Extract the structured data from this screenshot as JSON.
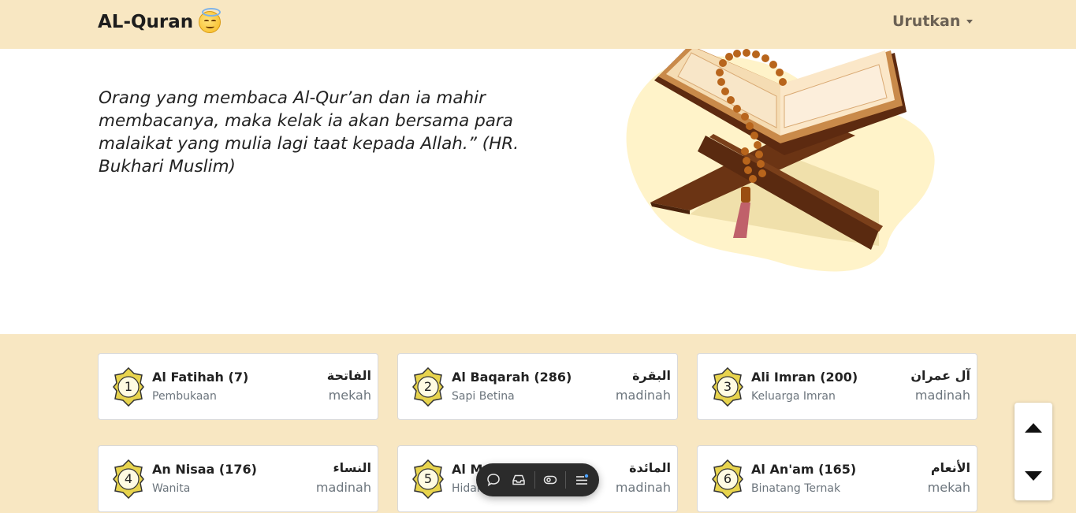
{
  "navbar": {
    "brand": "AL-Quran",
    "brand_emoji": "smiling-face-with-halo",
    "sort_label": "Urutkan"
  },
  "hero": {
    "quote": "Orang yang membaca Al-Qur’an dan ia mahir membacanya, maka kelak ia akan bersama para malaikat yang mulia lagi taat kepada Allah.” (HR. Bukhari Muslim)"
  },
  "surahs": [
    {
      "number": "1",
      "name": "Al Fatihah (7)",
      "meaning": "Pembukaan",
      "arabic": "الفاتحة",
      "place": "mekah"
    },
    {
      "number": "2",
      "name": "Al Baqarah (286)",
      "meaning": "Sapi Betina",
      "arabic": "البقرة",
      "place": "madinah"
    },
    {
      "number": "3",
      "name": "Ali Imran (200)",
      "meaning": "Keluarga Imran",
      "arabic": "آل عمران",
      "place": "madinah"
    },
    {
      "number": "4",
      "name": "An Nisaa (176)",
      "meaning": "Wanita",
      "arabic": "النساء",
      "place": "madinah"
    },
    {
      "number": "5",
      "name": "Al M",
      "meaning": "Hidan",
      "arabic": "المائدة",
      "place": "madinah"
    },
    {
      "number": "6",
      "name": "Al An'am (165)",
      "meaning": "Binatang Ternak",
      "arabic": "الأنعام",
      "place": "mekah"
    }
  ],
  "colors": {
    "header_bg": "#f8e7c2",
    "list_bg": "#f8e7c2",
    "badge_gold": "#e8d44d"
  },
  "toolbar_icons": [
    "comment-icon",
    "inbox-icon",
    "eye-icon",
    "menu-icon"
  ],
  "scroll_controls": [
    "scroll-up-icon",
    "scroll-down-icon"
  ]
}
